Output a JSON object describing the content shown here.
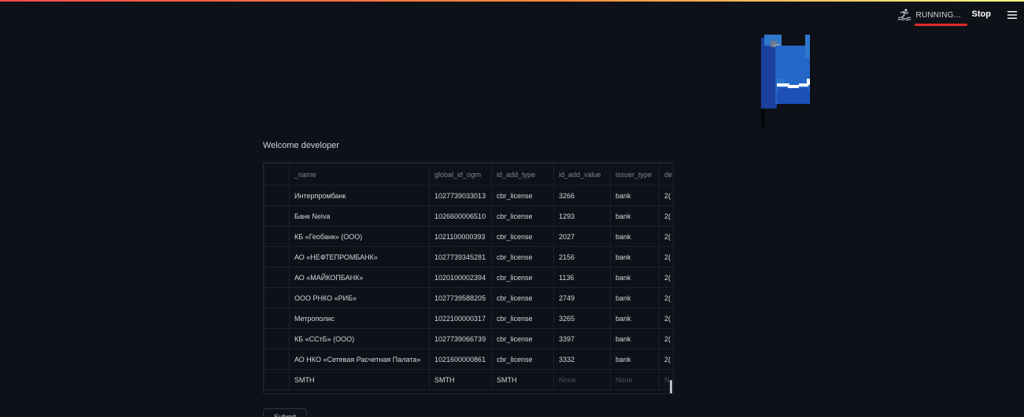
{
  "status": {
    "running_label": "RUNNING...",
    "stop_label": "Stop",
    "running_icon": "running-person-icon",
    "menu_icon": "hamburger-menu-icon"
  },
  "colors": {
    "background": "#0e1117",
    "running_bar": "#e0282d",
    "flag_blue": "#1f5fc8",
    "flag_dark": "#1a3f9c"
  },
  "main": {
    "welcome": "Welcome developer",
    "submit_label": "Submit"
  },
  "table": {
    "columns": [
      "_name",
      "global_id_ogrn",
      "id_add_type",
      "id_add_value",
      "issuer_type",
      "de"
    ],
    "rows": [
      [
        "Интерпромбанк",
        "1027739033013",
        "cbr_license",
        "3266",
        "bank",
        "2("
      ],
      [
        "Банк Neiva",
        "1026600006510",
        "cbr_license",
        "1293",
        "bank",
        "2("
      ],
      [
        "КБ «Геобанк» (ООО)",
        "1021100000393",
        "cbr_license",
        "2027",
        "bank",
        "2("
      ],
      [
        "АО «НЕФТЕПРОМБАНК»",
        "1027739345281",
        "cbr_license",
        "2156",
        "bank",
        "2("
      ],
      [
        "АО «МАЙКОПБАНК»",
        "1020100002394",
        "cbr_license",
        "1136",
        "bank",
        "2("
      ],
      [
        "ООО РНКО «РИБ»",
        "1027739588205",
        "cbr_license",
        "2749",
        "bank",
        "2("
      ],
      [
        "Метрополис",
        "1022100000317",
        "cbr_license",
        "3265",
        "bank",
        "2("
      ],
      [
        "КБ «ССтБ» (ООО)",
        "1027739066739",
        "cbr_license",
        "3397",
        "bank",
        "2("
      ],
      [
        "АО НКО «Сетевая Расчетная Палата»",
        "1021600000861",
        "cbr_license",
        "3332",
        "bank",
        "2("
      ],
      [
        "SMTH",
        "SMTH",
        "SMTH",
        "None",
        "None",
        "N"
      ]
    ]
  }
}
